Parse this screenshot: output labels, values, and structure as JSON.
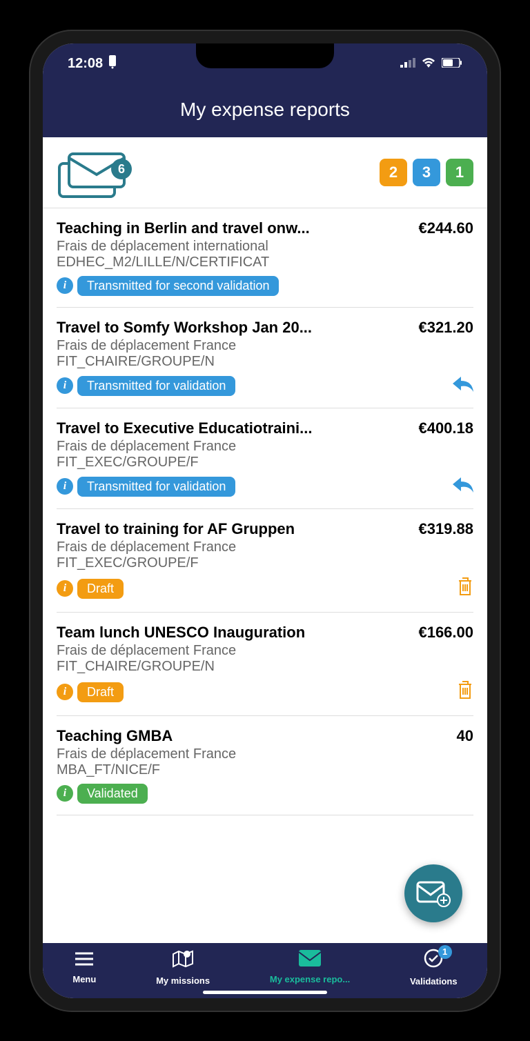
{
  "status_bar": {
    "time": "12:08"
  },
  "header": {
    "title": "My expense reports"
  },
  "summary": {
    "envelope_count": "6",
    "badges": [
      {
        "value": "2",
        "color": "orange"
      },
      {
        "value": "3",
        "color": "blue"
      },
      {
        "value": "1",
        "color": "green"
      }
    ]
  },
  "reports": [
    {
      "title": "Teaching in Berlin and travel onw...",
      "amount": "€244.60",
      "category": "Frais de déplacement international",
      "code": "EDHEC_M2/LILLE/N/CERTIFICAT",
      "status_label": "Transmitted for second validation",
      "status_color": "blue",
      "action": null
    },
    {
      "title": "Travel to Somfy Workshop Jan 20...",
      "amount": "€321.20",
      "category": "Frais de déplacement France",
      "code": "FIT_CHAIRE/GROUPE/N",
      "status_label": "Transmitted for validation",
      "status_color": "blue",
      "action": "reply"
    },
    {
      "title": "Travel to Executive Educatiotraini...",
      "amount": "€400.18",
      "category": "Frais de déplacement France",
      "code": "FIT_EXEC/GROUPE/F",
      "status_label": "Transmitted for validation",
      "status_color": "blue",
      "action": "reply"
    },
    {
      "title": "Travel to training for AF Gruppen",
      "amount": "€319.88",
      "category": "Frais de déplacement France",
      "code": "FIT_EXEC/GROUPE/F",
      "status_label": "Draft",
      "status_color": "orange",
      "action": "trash"
    },
    {
      "title": "Team lunch UNESCO Inauguration",
      "amount": "€166.00",
      "category": "Frais de déplacement France",
      "code": "FIT_CHAIRE/GROUPE/N",
      "status_label": "Draft",
      "status_color": "orange",
      "action": "trash"
    },
    {
      "title": "Teaching GMBA",
      "amount": "40",
      "category": "Frais de déplacement France",
      "code": "MBA_FT/NICE/F",
      "status_label": "Validated",
      "status_color": "green",
      "action": null
    }
  ],
  "nav": {
    "items": [
      {
        "label": "Menu",
        "icon": "menu",
        "active": false
      },
      {
        "label": "My missions",
        "icon": "map",
        "active": false
      },
      {
        "label": "My expense repo...",
        "icon": "mail",
        "active": true
      },
      {
        "label": "Validations",
        "icon": "check",
        "active": false,
        "badge": "1"
      }
    ]
  }
}
